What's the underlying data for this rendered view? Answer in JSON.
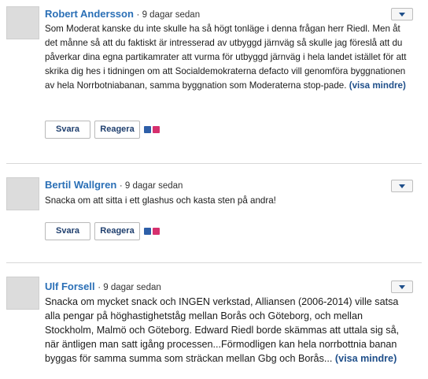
{
  "comments": [
    {
      "author": "Robert Andersson",
      "time": "· 9 dagar sedan",
      "text": "Som Moderat kanske du inte skulle ha så högt tonläge i denna frågan herr Riedl. Men åt det månne så att du faktiskt är intresserad av utbyggd järnväg så skulle jag föreslå att du påverkar dina egna partikamrater att vurma för utbyggd järnväg i hela landet istället för att skrika dig hes i tidningen om att Socialdemokraterna defacto vill genomföra byggnationen av hela Norrbotniabanan, samma byggnation som Moderaterna stop-pade.",
      "show_less": "(visa mindre)",
      "reply": "Svara",
      "react": "Reagera"
    },
    {
      "author": "Bertil Wallgren",
      "time": "· 9 dagar sedan",
      "text": "Snacka om att sitta i ett glashus och kasta sten på andra!",
      "reply": "Svara",
      "react": "Reagera"
    },
    {
      "author": "Ulf Forsell",
      "time": "· 9 dagar sedan",
      "text": "Snacka om mycket snack och INGEN verkstad, Alliansen (2006-2014) ville satsa alla pengar på höghastighetståg mellan Borås och Göteborg, och mellan Stockholm, Malmö och Göteborg. Edward Riedl borde skämmas att uttala sig så, när äntligen man satt igång processen...Förmodligen kan hela norrbottnia banan byggas för samma summa som sträckan mellan Gbg och Borås...",
      "show_less": "(visa mindre)"
    }
  ],
  "icons": {
    "menu": "chevron-down-icon",
    "emoji_a": "emoji-arrow-icon",
    "emoji_b": "emoji-heart-icon"
  },
  "colors": {
    "author": "#2a6fb6",
    "link": "#1f4f8a",
    "emoji_a": "#2e5fa8",
    "emoji_b": "#d6306e"
  }
}
